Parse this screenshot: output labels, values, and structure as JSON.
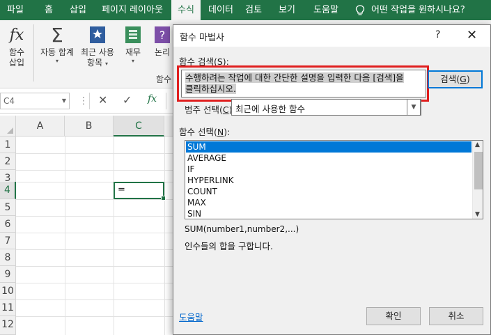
{
  "ribbon_tabs": [
    "파일",
    "홈",
    "삽입",
    "페이지 레이아웃",
    "수식",
    "데이터",
    "검토",
    "보기",
    "도움말"
  ],
  "active_tab": "수식",
  "tell_me": "어떤 작업을 원하시나요?",
  "ribbon": {
    "insert_function": {
      "line1": "함수",
      "line2": "삽입"
    },
    "autosum": {
      "label": "자동 합계"
    },
    "recently_used": {
      "line1": "최근 사용",
      "line2": "항목"
    },
    "financial": {
      "label": "재무"
    },
    "logical": {
      "label": "논리"
    },
    "group_label": "함수"
  },
  "formula_bar": {
    "name_box": "C4",
    "cancel_glyph": "✕",
    "enter_glyph": "✓",
    "fx_glyph": "fx"
  },
  "sheet": {
    "columns": [
      "A",
      "B",
      "C"
    ],
    "rows": [
      "1",
      "2",
      "3",
      "4",
      "5",
      "6",
      "7",
      "8",
      "9",
      "10",
      "11",
      "12"
    ],
    "active_cell_value": "="
  },
  "dialog": {
    "title": "함수 마법사",
    "help_glyph": "?",
    "close_glyph": "✕",
    "search_label_prefix": "함수 검색(",
    "search_label_key": "S",
    "search_label_suffix": "):",
    "search_text_line1": "수행하려는 작업에 대한 간단한 설명을 입력한 다음 [검색]을",
    "search_text_line2": "클릭하십시오.",
    "search_button_prefix": "검색(",
    "search_button_key": "G",
    "search_button_suffix": ")",
    "category_label_prefix": "범주 선택(",
    "category_label_key": "C",
    "category_label_suffix": "):",
    "category_value": "최근에 사용한 함수",
    "function_label_prefix": "함수 선택(",
    "function_label_key": "N",
    "function_label_suffix": "):",
    "functions": [
      "SUM",
      "AVERAGE",
      "IF",
      "HYPERLINK",
      "COUNT",
      "MAX",
      "SIN"
    ],
    "selected_function": "SUM",
    "syntax": "SUM(number1,number2,...)",
    "description": "인수들의 합을 구합니다.",
    "help_link": "도움말",
    "ok_label": "확인",
    "cancel_label": "취소"
  },
  "colors": {
    "excel_green": "#217346",
    "selection_blue": "#0078d7",
    "highlight_red": "#e01e1e"
  }
}
